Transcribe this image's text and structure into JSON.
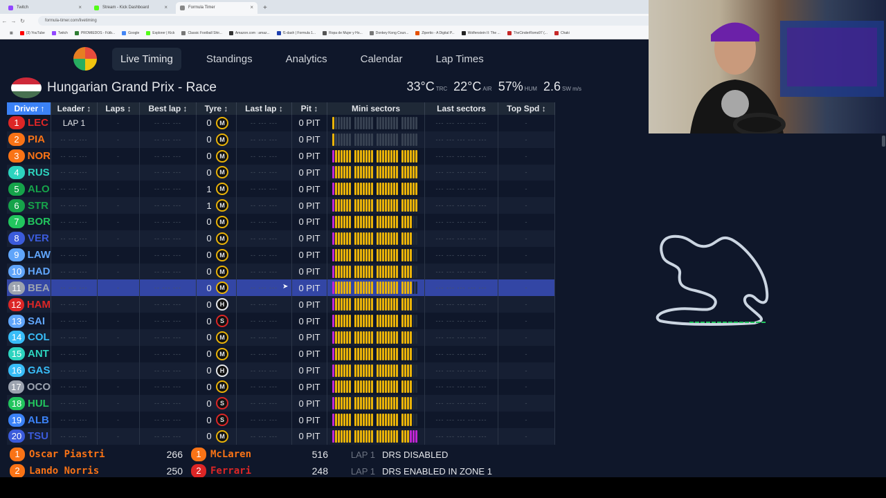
{
  "browser": {
    "tabs": [
      {
        "label": "Twitch",
        "color": "#9146ff",
        "active": false
      },
      {
        "label": "Stream - Kick Dashboard",
        "color": "#53fc18",
        "active": false
      },
      {
        "label": "Formula Timer",
        "color": "#888888",
        "active": true
      }
    ],
    "url": "formula-timer.com/livetiming",
    "bookmarks": [
      {
        "label": "(3) YouTube",
        "color": "#ff0000"
      },
      {
        "label": "Twitch",
        "color": "#9146ff"
      },
      {
        "label": "PROMIEDOS - Fútb...",
        "color": "#2e7d32"
      },
      {
        "label": "Google",
        "color": "#4285f4"
      },
      {
        "label": "Explorer | Kick",
        "color": "#53fc18"
      },
      {
        "label": "Classic Football Shir...",
        "color": "#777777"
      },
      {
        "label": "Amazon.com : amaz...",
        "color": "#333333"
      },
      {
        "label": "f1-dash | Formula 1...",
        "color": "#1e40af"
      },
      {
        "label": "Ropa de Mujer y Ho...",
        "color": "#555555"
      },
      {
        "label": "Donkey Kong Coun...",
        "color": "#777777"
      },
      {
        "label": "Zipertio - A Digital P...",
        "color": "#e65100"
      },
      {
        "label": "Wolfenstein II: The ...",
        "color": "#222222"
      },
      {
        "label": "TheCinderRoms97 (...",
        "color": "#c62828"
      },
      {
        "label": "Chaki",
        "color": "#c62828"
      }
    ]
  },
  "nav": {
    "items": [
      "Live Timing",
      "Standings",
      "Analytics",
      "Calendar",
      "Lap Times"
    ],
    "active": 0
  },
  "race": {
    "title": "Hungarian Grand Prix - Race",
    "flag_colors": [
      "#ce2939",
      "#ffffff",
      "#477050"
    ],
    "weather": [
      {
        "value": "33°C",
        "unit": "TRC"
      },
      {
        "value": "22°C",
        "unit": "AIR"
      },
      {
        "value": "57%",
        "unit": "HUM"
      },
      {
        "value": "2.6",
        "unit": "SW m/s"
      }
    ]
  },
  "table": {
    "headers": [
      "Driver ↑",
      "Leader ↕",
      "Laps ↕",
      "Best lap ↕",
      "Tyre ↕",
      "Last lap ↕",
      "Pit ↕",
      "Mini sectors",
      "Last sectors",
      "Top Spd ↕"
    ],
    "active_header": 0,
    "placeholder_time": "-- --- ---",
    "placeholder_short": "-",
    "placeholder_sectors": "--- --- --- --- ---",
    "rows": [
      {
        "pos": "1",
        "abbr": "LEC",
        "color": "#dc2626",
        "leader": "LAP 1",
        "tyres_used": "0",
        "compound": "M",
        "pit": "0 PIT",
        "mini": "lead"
      },
      {
        "pos": "2",
        "abbr": "PIA",
        "color": "#f97316",
        "leader": "",
        "tyres_used": "0",
        "compound": "M",
        "pit": "0 PIT",
        "mini": "second"
      },
      {
        "pos": "3",
        "abbr": "NOR",
        "color": "#f97316",
        "leader": "",
        "tyres_used": "0",
        "compound": "M",
        "pit": "0 PIT",
        "mini": "full"
      },
      {
        "pos": "4",
        "abbr": "RUS",
        "color": "#2dd4bf",
        "leader": "",
        "tyres_used": "0",
        "compound": "M",
        "pit": "0 PIT",
        "mini": "full"
      },
      {
        "pos": "5",
        "abbr": "ALO",
        "color": "#16a34a",
        "leader": "",
        "tyres_used": "1",
        "compound": "M",
        "pit": "0 PIT",
        "mini": "full"
      },
      {
        "pos": "6",
        "abbr": "STR",
        "color": "#16a34a",
        "leader": "",
        "tyres_used": "1",
        "compound": "M",
        "pit": "0 PIT",
        "mini": "full"
      },
      {
        "pos": "7",
        "abbr": "BOR",
        "color": "#22c55e",
        "leader": "",
        "tyres_used": "0",
        "compound": "M",
        "pit": "0 PIT",
        "mini": "part"
      },
      {
        "pos": "8",
        "abbr": "VER",
        "color": "#3b5bdb",
        "leader": "",
        "tyres_used": "0",
        "compound": "M",
        "pit": "0 PIT",
        "mini": "part"
      },
      {
        "pos": "9",
        "abbr": "LAW",
        "color": "#60a5fa",
        "leader": "",
        "tyres_used": "0",
        "compound": "M",
        "pit": "0 PIT",
        "mini": "part"
      },
      {
        "pos": "10",
        "abbr": "HAD",
        "color": "#60a5fa",
        "leader": "",
        "tyres_used": "0",
        "compound": "M",
        "pit": "0 PIT",
        "mini": "part"
      },
      {
        "pos": "11",
        "abbr": "BEA",
        "color": "#9ca3af",
        "leader": "",
        "tyres_used": "0",
        "compound": "M",
        "pit": "0 PIT",
        "mini": "part",
        "selected": true
      },
      {
        "pos": "12",
        "abbr": "HAM",
        "color": "#dc2626",
        "leader": "",
        "tyres_used": "0",
        "compound": "H",
        "pit": "0 PIT",
        "mini": "part"
      },
      {
        "pos": "13",
        "abbr": "SAI",
        "color": "#60a5fa",
        "leader": "",
        "tyres_used": "0",
        "compound": "S",
        "pit": "0 PIT",
        "mini": "part"
      },
      {
        "pos": "14",
        "abbr": "COL",
        "color": "#38bdf8",
        "leader": "",
        "tyres_used": "0",
        "compound": "M",
        "pit": "0 PIT",
        "mini": "part"
      },
      {
        "pos": "15",
        "abbr": "ANT",
        "color": "#2dd4bf",
        "leader": "",
        "tyres_used": "0",
        "compound": "M",
        "pit": "0 PIT",
        "mini": "part"
      },
      {
        "pos": "16",
        "abbr": "GAS",
        "color": "#38bdf8",
        "leader": "",
        "tyres_used": "0",
        "compound": "H",
        "pit": "0 PIT",
        "mini": "part"
      },
      {
        "pos": "17",
        "abbr": "OCO",
        "color": "#9ca3af",
        "leader": "",
        "tyres_used": "0",
        "compound": "M",
        "pit": "0 PIT",
        "mini": "part"
      },
      {
        "pos": "18",
        "abbr": "HUL",
        "color": "#22c55e",
        "leader": "",
        "tyres_used": "0",
        "compound": "S",
        "pit": "0 PIT",
        "mini": "part"
      },
      {
        "pos": "19",
        "abbr": "ALB",
        "color": "#3b82f6",
        "leader": "",
        "tyres_used": "0",
        "compound": "S",
        "pit": "0 PIT",
        "mini": "part"
      },
      {
        "pos": "20",
        "abbr": "TSU",
        "color": "#3b5bdb",
        "leader": "",
        "tyres_used": "0",
        "compound": "M",
        "pit": "0 PIT",
        "mini": "last"
      }
    ]
  },
  "standings": {
    "drivers": [
      {
        "pos": "1",
        "name": "Oscar Piastri",
        "points": "266",
        "color": "#f97316"
      },
      {
        "pos": "2",
        "name": "Lando Norris",
        "points": "250",
        "color": "#f97316"
      }
    ],
    "constructors": [
      {
        "pos": "1",
        "name": "McLaren",
        "points": "516",
        "color": "#f97316"
      },
      {
        "pos": "2",
        "name": "Ferrari",
        "points": "248",
        "color": "#dc2626"
      }
    ]
  },
  "race_control": [
    {
      "lap": "LAP 1",
      "message": "DRS DISABLED"
    },
    {
      "lap": "LAP 1",
      "message": "DRS ENABLED IN ZONE 1"
    }
  ],
  "track_map": {
    "label": "Hungaroring track map"
  },
  "colors": {
    "accent": "#3b82f6",
    "selected_row": "#3346a5",
    "background": "#0f172a"
  }
}
